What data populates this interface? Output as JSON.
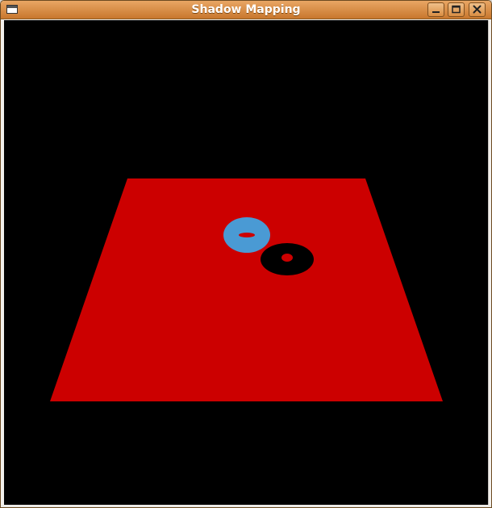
{
  "window": {
    "title": "Shadow Mapping",
    "icons": {
      "app": "application-window-icon",
      "minimize": "minimize-icon",
      "maximize": "maximize-icon",
      "close": "close-icon"
    },
    "colors": {
      "titlebar_top": "#e9a664",
      "titlebar_bottom": "#c8772d",
      "title_text": "#ffffff"
    }
  },
  "scene": {
    "background_color": "#000000",
    "floor_color": "#cc0000",
    "torus_color": "#4a9ad4",
    "shadow_color": "#000000"
  }
}
